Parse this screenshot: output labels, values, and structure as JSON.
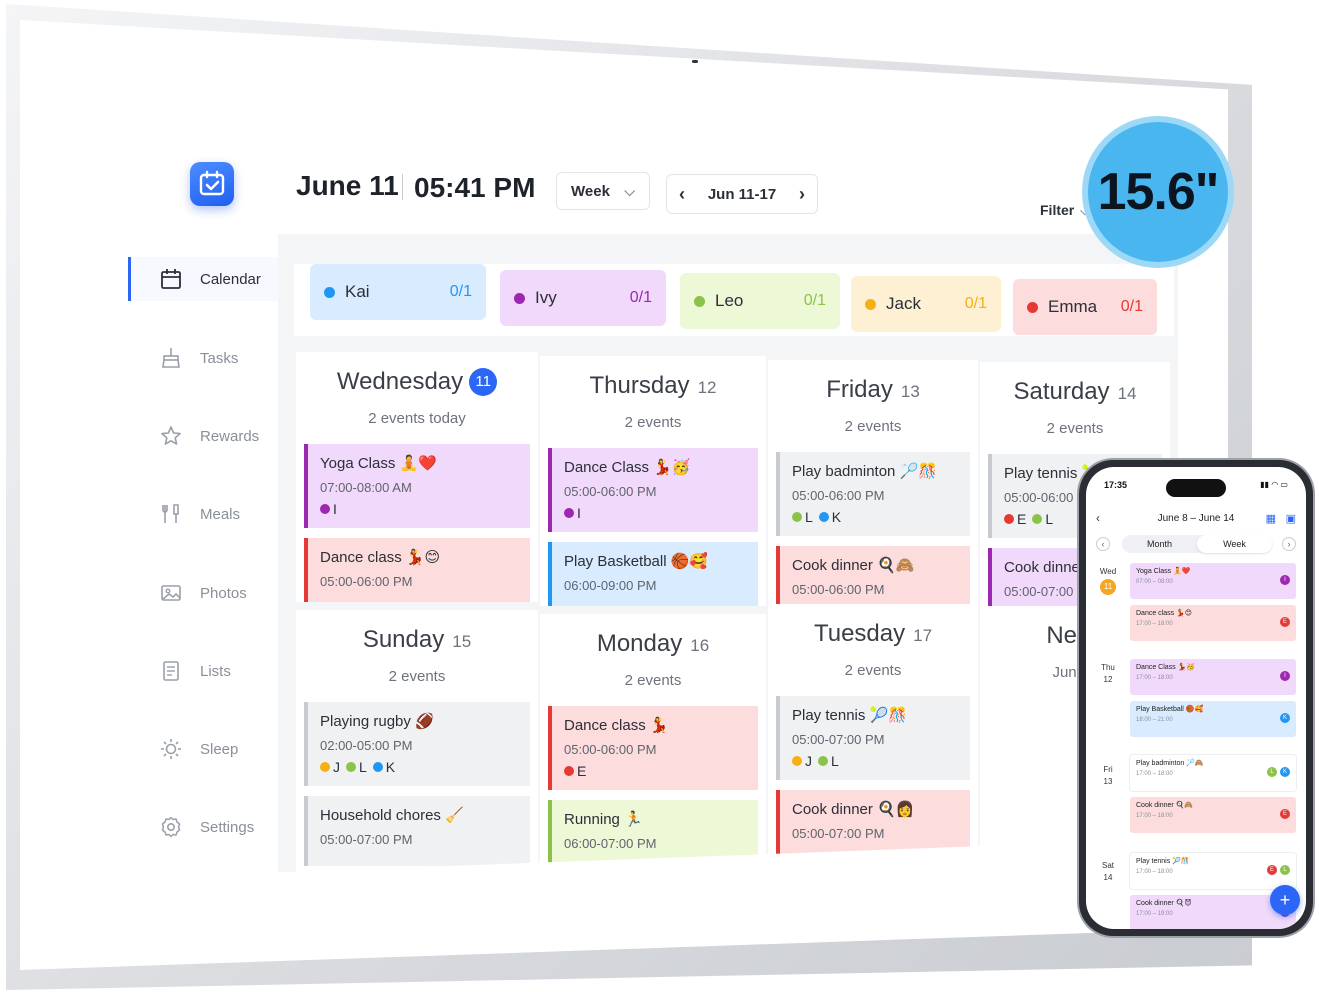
{
  "header": {
    "date": "June 11",
    "time": "05:41 PM",
    "view": "Week",
    "range": "Jun 11-17",
    "filter": "Filter"
  },
  "sidebar": {
    "items": [
      {
        "label": "Calendar",
        "icon": "calendar-icon"
      },
      {
        "label": "Tasks",
        "icon": "broom-icon"
      },
      {
        "label": "Rewards",
        "icon": "star-icon"
      },
      {
        "label": "Meals",
        "icon": "utensils-icon"
      },
      {
        "label": "Photos",
        "icon": "photo-icon"
      },
      {
        "label": "Lists",
        "icon": "list-icon"
      },
      {
        "label": "Sleep",
        "icon": "sun-icon"
      },
      {
        "label": "Settings",
        "icon": "gear-icon"
      }
    ]
  },
  "people": [
    {
      "name": "Kai",
      "count": "0/1",
      "color": "#2196f3",
      "bg": "#d9ecff"
    },
    {
      "name": "Ivy",
      "count": "0/1",
      "color": "#9c27b0",
      "bg": "#f1d9fb"
    },
    {
      "name": "Leo",
      "count": "0/1",
      "color": "#8bc34a",
      "bg": "#edf8d6"
    },
    {
      "name": "Jack",
      "count": "0/1",
      "color": "#f5b014",
      "bg": "#fdf0d3"
    },
    {
      "name": "Emma",
      "count": "0/1",
      "color": "#e53935",
      "bg": "#fcdcdc"
    }
  ],
  "days": [
    {
      "name": "Wednesday",
      "num": "11",
      "sub": "2 events today",
      "today": true,
      "events": [
        {
          "title": "Yoga Class 🧘❤️",
          "time": "07:00-08:00 AM",
          "people": [
            "I"
          ],
          "bg": "#f1d9fb",
          "bar": "#9c27b0"
        },
        {
          "title": "Dance class 💃😊",
          "time": "05:00-06:00 PM",
          "people": [],
          "bg": "#fcdcdc",
          "bar": "#e53935"
        }
      ]
    },
    {
      "name": "Thursday",
      "num": "12",
      "sub": "2 events",
      "events": [
        {
          "title": "Dance Class 💃🥳",
          "time": "05:00-06:00 PM",
          "people": [
            "I"
          ],
          "bg": "#f1d9fb",
          "bar": "#9c27b0"
        },
        {
          "title": "Play Basketball 🏀🥰",
          "time": "06:00-09:00 PM",
          "people": [],
          "bg": "#d9ecff",
          "bar": "#2196f3"
        }
      ]
    },
    {
      "name": "Friday",
      "num": "13",
      "sub": "2 events",
      "events": [
        {
          "title": "Play badminton 🏸🎊",
          "time": "05:00-06:00 PM",
          "people": [
            "L",
            "K"
          ],
          "bg": "#f0f1f3",
          "bar": "#c7cad0"
        },
        {
          "title": "Cook dinner 🍳🙈",
          "time": "05:00-06:00 PM",
          "people": [],
          "bg": "#fcdcdc",
          "bar": "#e53935"
        }
      ]
    },
    {
      "name": "Saturday",
      "num": "14",
      "sub": "2 events",
      "events": [
        {
          "title": "Play tennis 🎾🎊",
          "time": "05:00-06:00 PM",
          "people": [
            "E",
            "L"
          ],
          "bg": "#f0f1f3",
          "bar": "#c7cad0"
        },
        {
          "title": "Cook dinner 🍳",
          "time": "05:00-07:00 PM",
          "people": [],
          "bg": "#f1d9fb",
          "bar": "#9c27b0"
        }
      ]
    },
    {
      "name": "Sunday",
      "num": "15",
      "sub": "2 events",
      "events": [
        {
          "title": "Playing rugby 🏈",
          "time": "02:00-05:00 PM",
          "people": [
            "J",
            "L",
            "K"
          ],
          "bg": "#f0f1f3",
          "bar": "#c7cad0"
        },
        {
          "title": "Household chores 🧹",
          "time": "05:00-07:00 PM",
          "people": [],
          "bg": "#f0f1f3",
          "bar": "#c7cad0"
        }
      ]
    },
    {
      "name": "Monday",
      "num": "16",
      "sub": "2 events",
      "events": [
        {
          "title": "Dance class 💃",
          "time": "05:00-06:00 PM",
          "people": [
            "E"
          ],
          "bg": "#fcdcdc",
          "bar": "#e53935"
        },
        {
          "title": "Running 🏃",
          "time": "06:00-07:00 PM",
          "people": [],
          "bg": "#edf8d6",
          "bar": "#8bc34a"
        }
      ]
    },
    {
      "name": "Tuesday",
      "num": "17",
      "sub": "2 events",
      "events": [
        {
          "title": "Play tennis 🎾🎊",
          "time": "05:00-07:00 PM",
          "people": [
            "J",
            "L"
          ],
          "bg": "#f0f1f3",
          "bar": "#c7cad0"
        },
        {
          "title": "Cook dinner 🍳👩",
          "time": "05:00-07:00 PM",
          "people": [],
          "bg": "#fcdcdc",
          "bar": "#e53935"
        }
      ]
    },
    {
      "name": "Next",
      "num": "",
      "sub": "Jun 18",
      "events": []
    }
  ],
  "badge": "15.6\"",
  "phone": {
    "clock": "17:35",
    "range": "June 8 – June 14",
    "tabs": [
      "Month",
      "Week"
    ],
    "days": [
      {
        "label": "Wed",
        "num": "11",
        "today": true
      },
      {
        "label": "Thu",
        "num": "12"
      },
      {
        "label": "Fri",
        "num": "13"
      },
      {
        "label": "Sat",
        "num": "14"
      }
    ],
    "events": [
      {
        "title": "Yoga Class 🧘❤️",
        "time": "07:00 – 08:00",
        "bg": "#f1d9fb",
        "people": [
          {
            "l": "I",
            "c": "#9c27b0"
          }
        ]
      },
      {
        "title": "Dance class 💃😊",
        "time": "17:00 – 18:00",
        "bg": "#fcdcdc",
        "people": [
          {
            "l": "E",
            "c": "#e53935"
          }
        ]
      },
      {
        "title": "Dance Class 💃🥳",
        "time": "17:00 – 18:00",
        "bg": "#f1d9fb",
        "people": [
          {
            "l": "I",
            "c": "#9c27b0"
          }
        ]
      },
      {
        "title": "Play Basketball 🏀🥰",
        "time": "18:00 – 21:00",
        "bg": "#d9ecff",
        "people": [
          {
            "l": "K",
            "c": "#2196f3"
          }
        ]
      },
      {
        "title": "Play badminton 🏸🙈",
        "time": "17:00 – 18:00",
        "bg": "#ffffff",
        "people": [
          {
            "l": "L",
            "c": "#8bc34a"
          },
          {
            "l": "K",
            "c": "#2196f3"
          }
        ]
      },
      {
        "title": "Cook dinner 🍳🙈",
        "time": "17:00 – 18:00",
        "bg": "#fcdcdc",
        "people": [
          {
            "l": "E",
            "c": "#e53935"
          }
        ]
      },
      {
        "title": "Play tennis 🎾🎊",
        "time": "17:00 – 18:00",
        "bg": "#ffffff",
        "people": [
          {
            "l": "E",
            "c": "#e53935"
          },
          {
            "l": "L",
            "c": "#8bc34a"
          }
        ]
      },
      {
        "title": "Cook dinner 🍳😈",
        "time": "17:00 – 19:00",
        "bg": "#f1d9fb",
        "people": [
          {
            "l": "I",
            "c": "#9c27b0"
          }
        ]
      }
    ]
  },
  "colors": {
    "accent": "#2b66f6",
    "badge": "#49b6ef"
  },
  "person_colors": {
    "I": "#9c27b0",
    "E": "#e53935",
    "L": "#8bc34a",
    "K": "#2196f3",
    "J": "#f5b014"
  }
}
